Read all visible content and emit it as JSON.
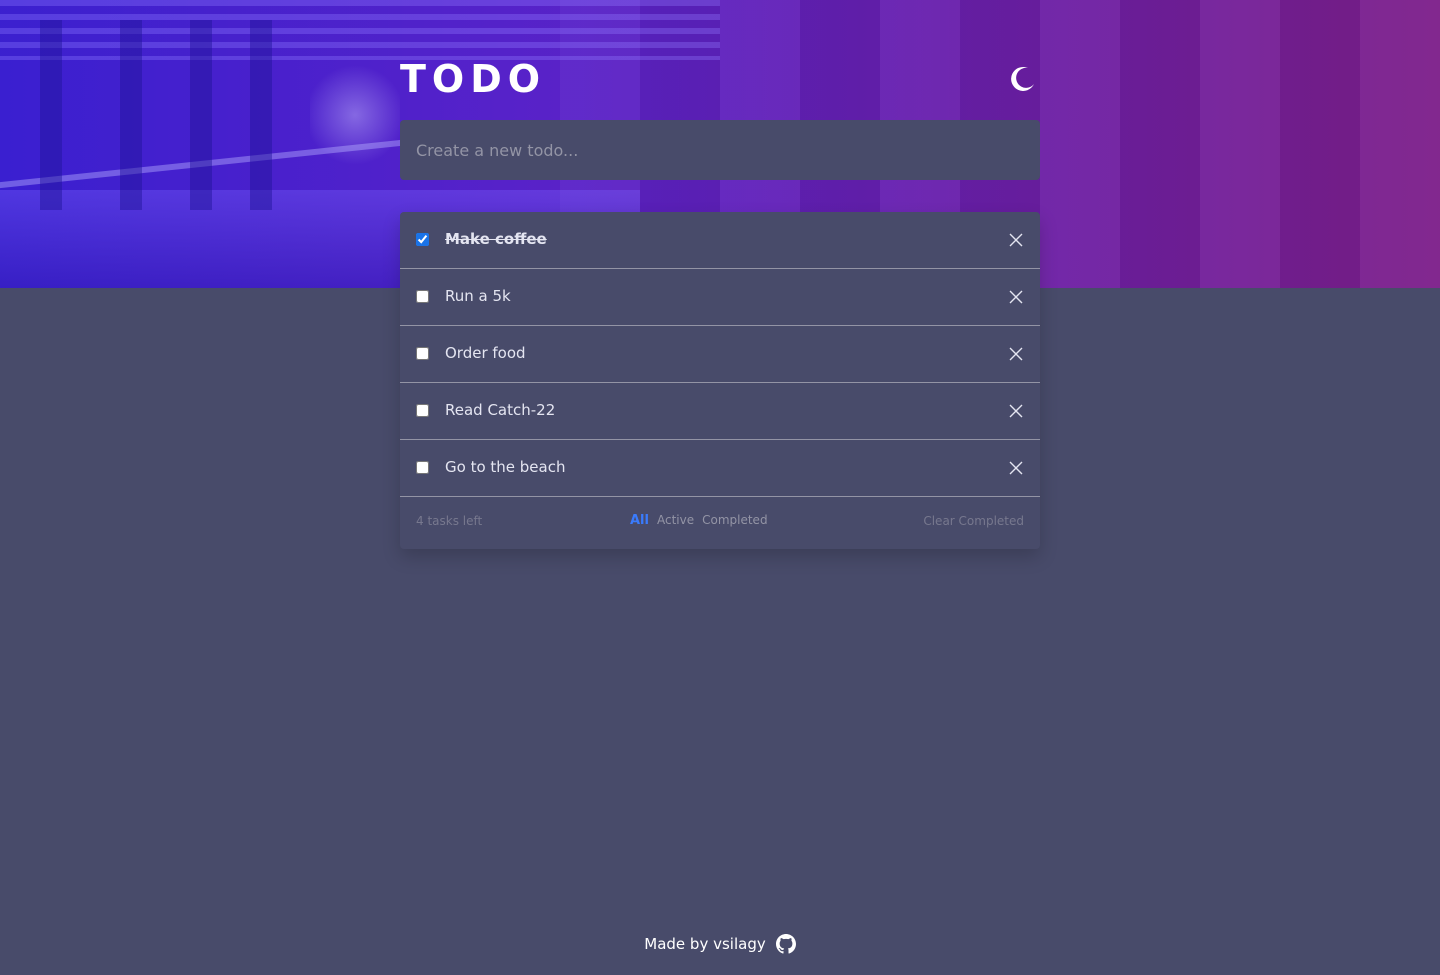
{
  "header": {
    "title": "TODO",
    "theme_icon": "moon-icon"
  },
  "new_todo": {
    "placeholder": "Create a new todo...",
    "value": ""
  },
  "todos": [
    {
      "label": "Make coffee",
      "completed": true
    },
    {
      "label": "Run a 5k",
      "completed": false
    },
    {
      "label": "Order food",
      "completed": false
    },
    {
      "label": "Read Catch-22",
      "completed": false
    },
    {
      "label": "Go to the beach",
      "completed": false
    }
  ],
  "footer": {
    "count_text": "4 tasks left",
    "filters": [
      "All",
      "Active",
      "Completed"
    ],
    "active_filter": "All",
    "clear_label": "Clear Completed"
  },
  "credit": {
    "text": "Made by vsilagy",
    "icon": "github-icon"
  },
  "colors": {
    "background": "#484b6a",
    "accent": "#3a7bfd",
    "hero_start": "#3a1fd0",
    "hero_end": "#7d1f8a"
  }
}
